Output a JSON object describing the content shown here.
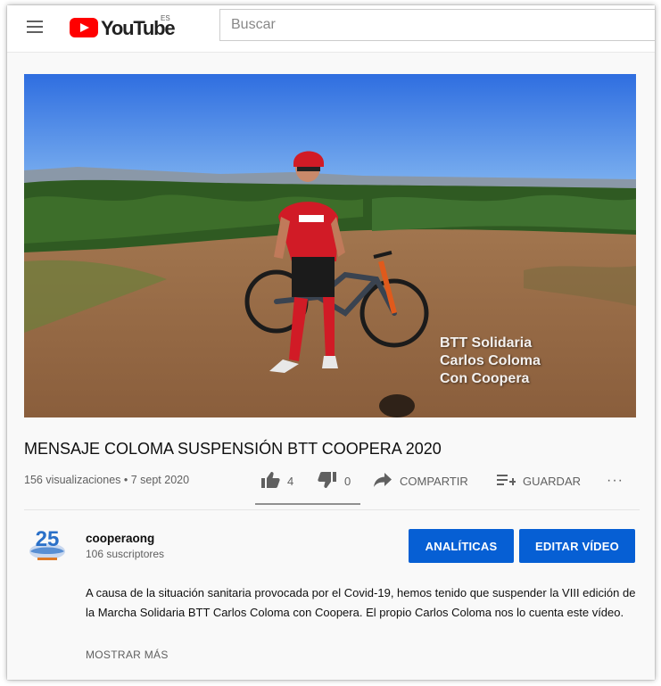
{
  "header": {
    "logo_text": "YouTube",
    "logo_region": "ES",
    "search_placeholder": "Buscar"
  },
  "video": {
    "overlay_lines": [
      "BTT Solidaria",
      "Carlos Coloma",
      "Con Coopera"
    ],
    "title": "MENSAJE COLOMA SUSPENSIÓN BTT COOPERA 2020",
    "meta": "156 visualizaciones • 7 sept 2020"
  },
  "actions": {
    "likes": "4",
    "dislikes": "0",
    "share_label": "COMPARTIR",
    "save_label": "GUARDAR",
    "more_label": "···"
  },
  "channel": {
    "avatar_text": "25",
    "name": "cooperaong",
    "subscribers": "106 suscriptores"
  },
  "buttons": {
    "analytics": "ANALÍTICAS",
    "edit": "EDITAR VÍDEO"
  },
  "description": {
    "text": "A causa de la situación sanitaria provocada por el Covid-19, hemos tenido que suspender la VIII edición de la Marcha Solidaria BTT Carlos Coloma con Coopera. El propio Carlos Coloma nos lo cuenta este vídeo.",
    "show_more": "MOSTRAR MÁS"
  },
  "colors": {
    "brand_red": "#ff0000",
    "button_blue": "#065fd4"
  }
}
